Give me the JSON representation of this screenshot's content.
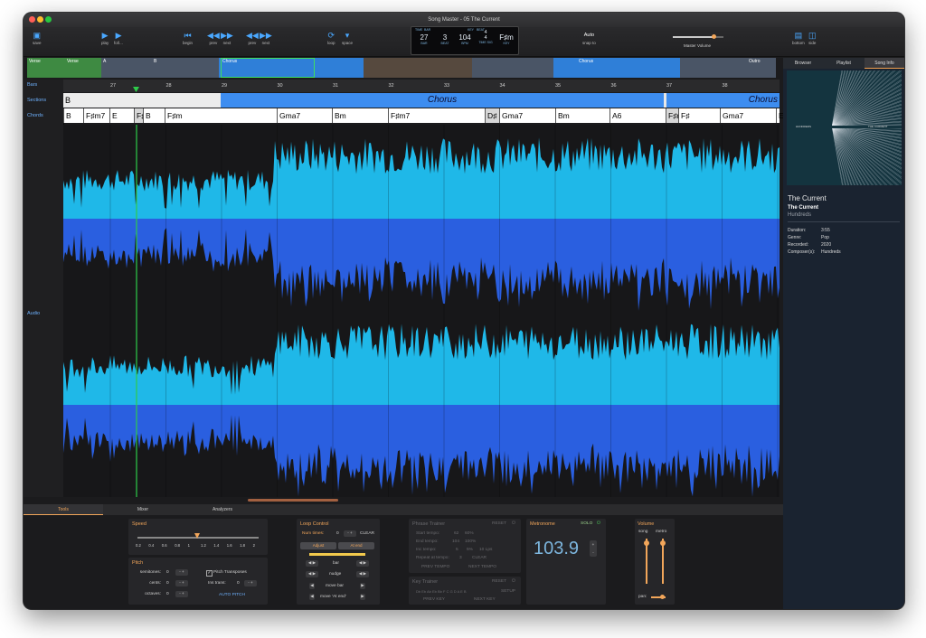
{
  "window": {
    "title": "Song Master - 05 The Current"
  },
  "toolbar": {
    "save_label": "save",
    "play_label": "play",
    "follow_label": "foll…",
    "begin_label": "begin",
    "prev_label": "prev",
    "next_label": "next",
    "prev2_label": "prev",
    "next2_label": "next",
    "loop_label": "loop",
    "space_label": "space",
    "auto_label": "Auto",
    "snap_label": "snap to",
    "master_volume_label": "Master Volume",
    "master_volume_level": 0.8,
    "bottom_label": "bottom",
    "side_label": "side"
  },
  "lcd": {
    "bar_cap": "BAR",
    "bar": "27",
    "beat_cap": "BEAT",
    "beat": "3",
    "bpm_cap": "BPM",
    "bpm": "104",
    "timesig_cap": "TIME SIG",
    "timesig_top": "4",
    "timesig_bottom": "4",
    "key_cap": "KEY",
    "key": "F♯m",
    "top_caps": [
      "TIME",
      "BAR",
      "KEY",
      "BEAT"
    ]
  },
  "overview": {
    "labels": [
      "Verse",
      "Verse",
      "A",
      "B",
      "Chorus",
      "Chorus",
      "Outro"
    ]
  },
  "tracks": {
    "bars": "Bars",
    "sections": "Sections",
    "chords": "Chords",
    "audio": "Audio"
  },
  "ruler": {
    "bars": [
      "27",
      "28",
      "29",
      "30",
      "31",
      "32",
      "33",
      "34",
      "35",
      "36",
      "37",
      "38"
    ]
  },
  "sections": {
    "left": "B",
    "chorus": "Chorus",
    "chorus2": "Chorus"
  },
  "chords": [
    "B",
    "F♯m7",
    "E",
    "F♯",
    "B",
    "F♯m",
    "Gma7",
    "Bm",
    "F♯m7",
    "D♯",
    "Gma7",
    "Bm",
    "A6",
    "F♯m",
    "F♯",
    "Gma7",
    "E"
  ],
  "right_panel": {
    "tabs": [
      "Browser",
      "Playlist",
      "Song Info"
    ],
    "art_text_left": "HUNDREDS",
    "art_text_right": "THE CURRENT",
    "song_title": "The Current",
    "album": "The Current",
    "artist": "Hundreds",
    "duration_label": "Duration:",
    "duration": "3:55",
    "genre_label": "Genre:",
    "genre": "Pop",
    "recorded_label": "Recorded:",
    "recorded": "2020",
    "composer_label": "Composer(s):",
    "composer": "Hundreds"
  },
  "bottom_tabs": [
    "Tools",
    "Mixer",
    "Analyzers"
  ],
  "speed": {
    "title": "Speed",
    "ticks": [
      "0.2",
      "0.4",
      "0.6",
      "0.8",
      "1",
      "1.2",
      "1.4",
      "1.6",
      "1.8",
      "2"
    ]
  },
  "pitch": {
    "title": "Pitch",
    "semitones_label": "semitones:",
    "semitones": "0",
    "cents_label": "cents:",
    "cents": "0",
    "octaves_label": "octaves:",
    "octaves": "0",
    "transposes_label": "Pitch Transposes",
    "ins_trans_label": "Ins trans:",
    "ins_trans": "0",
    "auto_pitch": "AUTO PITCH"
  },
  "loop": {
    "title": "Loop Control",
    "num_times_label": "Num times:",
    "num_times": "0",
    "clear": "CLEAR",
    "adjust": "Adjust",
    "at_end": "At end",
    "bar": "bar",
    "nudge": "nudge",
    "move_bar": "move bar",
    "move_at_end": "move 'At end'"
  },
  "phrase": {
    "title": "Phrase Trainer",
    "reset": "RESET",
    "start_label": "Start tempo:",
    "start": "62",
    "start_pct": "60%",
    "end_label": "End tempo:",
    "end": "104",
    "end_pct": "100%",
    "inc_label": "Inc tempo:",
    "inc": "5",
    "inc_pct": "5%",
    "inc_bpm": "10 Lps",
    "repeat_label": "Repeat at tempo:",
    "repeat": "3",
    "clear": "CLEAR",
    "prev_tempo": "PREV TEMPO",
    "next_tempo": "NEXT TEMPO"
  },
  "key_trainer": {
    "title": "Key Trainer",
    "reset": "RESET",
    "keys": "Db Eb Ab Eb Bb F C G D A E B",
    "setup": "SETUP",
    "prev_key": "PREV KEY",
    "next_key": "NEXT KEY"
  },
  "metronome": {
    "title": "Metronome",
    "solo": "SOLO",
    "bpm": "103.9"
  },
  "volume": {
    "title": "Volume",
    "song": "song",
    "metro": "metro",
    "pan": "pan:"
  },
  "colors": {
    "accent": "#4aa8ff",
    "wave_light": "#1fb8e8",
    "wave_dark": "#2a5fe0",
    "chorus": "#3d8df0",
    "playhead": "#2ecc4a"
  }
}
